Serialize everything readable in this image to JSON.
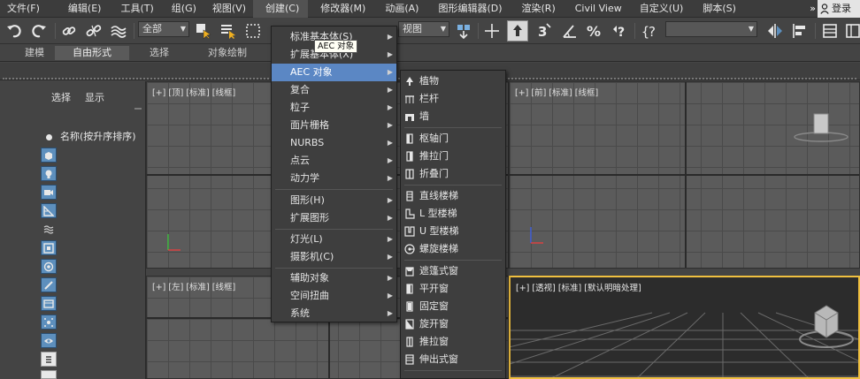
{
  "menubar": {
    "items": [
      "文件(F)",
      "编辑(E)",
      "工具(T)",
      "组(G)",
      "视图(V)",
      "创建(C)",
      "修改器(M)",
      "动画(A)",
      "图形编辑器(D)",
      "渲染(R)",
      "Civil View",
      "自定义(U)",
      "脚本(S)"
    ],
    "more": "»",
    "login": "登录"
  },
  "toolbar": {
    "filter_select": "全部",
    "view_select": "视图",
    "named_set_select": ""
  },
  "ribbon": {
    "tabs": [
      "建模",
      "自由形式",
      "选择",
      "对象绘制"
    ],
    "active_tab": "自由形式"
  },
  "explorer": {
    "tabs": [
      "选择",
      "显示"
    ],
    "column_header": "名称(按升序排序)"
  },
  "viewports": {
    "top": "[+] [顶] [标准] [线框]",
    "front": "[+] [前] [标准] [线框]",
    "left": "[+] [左] [标准] [线框]",
    "perspective": "[+] [透视] [标准] [默认明暗处理]"
  },
  "create_menu": {
    "items": [
      "标准基本体(S)",
      "扩展基本体(X)",
      "AEC 对象",
      "复合",
      "粒子",
      "面片栅格",
      "NURBS",
      "点云",
      "动力学",
      "图形(H)",
      "扩展图形",
      "灯光(L)",
      "摄影机(C)",
      "辅助对象",
      "空间扭曲",
      "系统"
    ],
    "highlighted": "AEC 对象"
  },
  "tooltip": "AEC 对象",
  "aec_menu": {
    "items": [
      "植物",
      "栏杆",
      "墙",
      "枢轴门",
      "推拉门",
      "折叠门",
      "直线楼梯",
      "L 型楼梯",
      "U 型楼梯",
      "螺旋楼梯",
      "遮篷式窗",
      "平开窗",
      "固定窗",
      "旋开窗",
      "推拉窗",
      "伸出式窗"
    ]
  },
  "colors": {
    "accent": "#5b87c4",
    "active_viewport_border": "#f0c040",
    "explorer_button": "#5d8fbd"
  }
}
